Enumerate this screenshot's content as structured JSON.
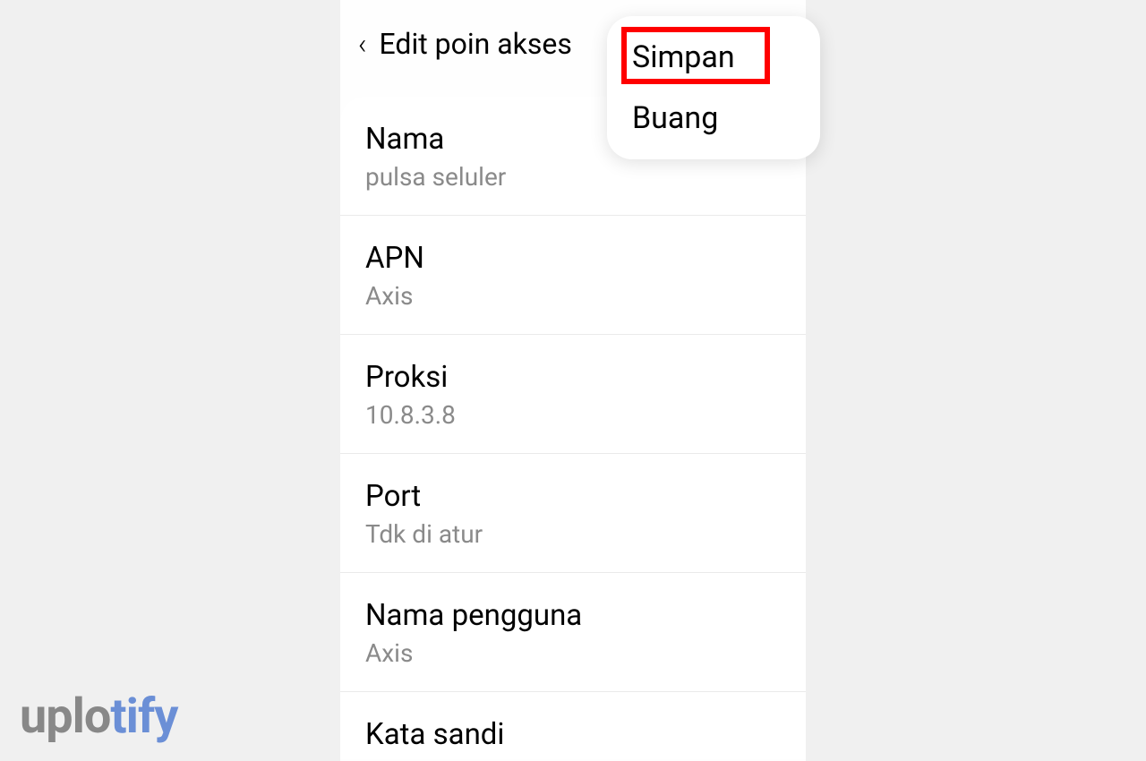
{
  "header": {
    "title": "Edit poin akses"
  },
  "popup": {
    "save": "Simpan",
    "discard": "Buang"
  },
  "settings": [
    {
      "label": "Nama",
      "value": "pulsa seluler"
    },
    {
      "label": "APN",
      "value": "Axis"
    },
    {
      "label": "Proksi",
      "value": "10.8.3.8"
    },
    {
      "label": "Port",
      "value": "Tdk di atur"
    },
    {
      "label": "Nama pengguna",
      "value": "Axis"
    },
    {
      "label": "Kata sandi",
      "value": ""
    }
  ],
  "watermark": {
    "part1": "uplo",
    "part2": "tify"
  },
  "colors": {
    "highlight": "#ff0000",
    "watermark_accent": "#6b8fd6"
  }
}
